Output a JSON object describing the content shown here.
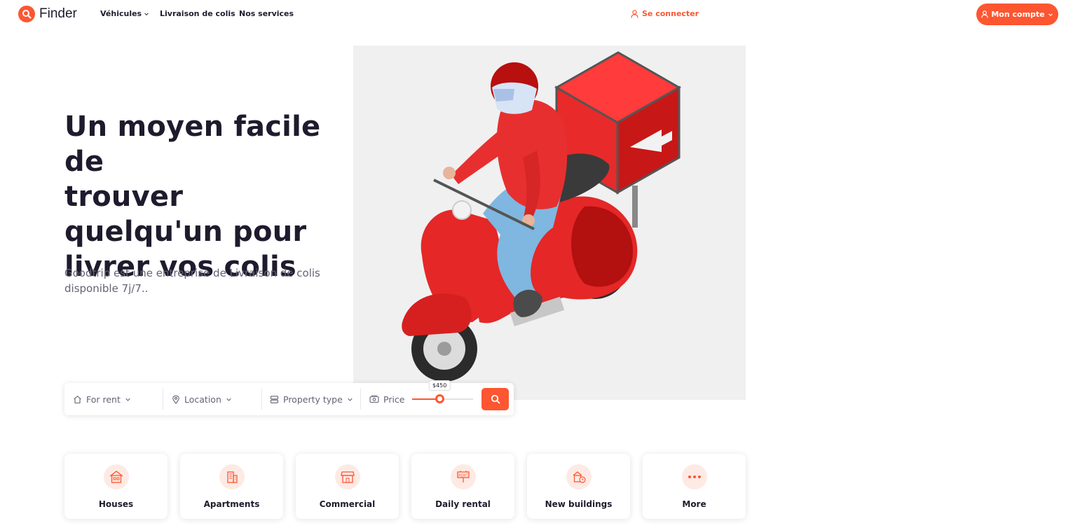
{
  "brand": {
    "name": "Finder",
    "accent": "#fd5631"
  },
  "nav": {
    "vehicles": "Véhicules",
    "delivery": "Livraison de colis",
    "services": "Nos services",
    "signin": "Se connecter",
    "account": "Mon compte"
  },
  "hero": {
    "title_lines": [
      "Un moyen facile de",
      "trouver",
      "quelqu'un pour",
      "livrer vos colis"
    ],
    "subtitle": "Goodtrip est une entreprise de Livraison de colis disponible 7j/7.."
  },
  "search": {
    "rent": "For rent",
    "location": "Location",
    "property_type": "Property type",
    "price": "Price",
    "price_value": "$450",
    "price_fraction": 0.45
  },
  "categories": [
    {
      "label": "Houses",
      "icon": "house-icon"
    },
    {
      "label": "Apartments",
      "icon": "apartment-icon"
    },
    {
      "label": "Commercial",
      "icon": "shop-icon"
    },
    {
      "label": "Daily rental",
      "icon": "rent-sign-icon"
    },
    {
      "label": "New buildings",
      "icon": "new-building-icon"
    },
    {
      "label": "More",
      "icon": "more-dots-icon"
    }
  ]
}
